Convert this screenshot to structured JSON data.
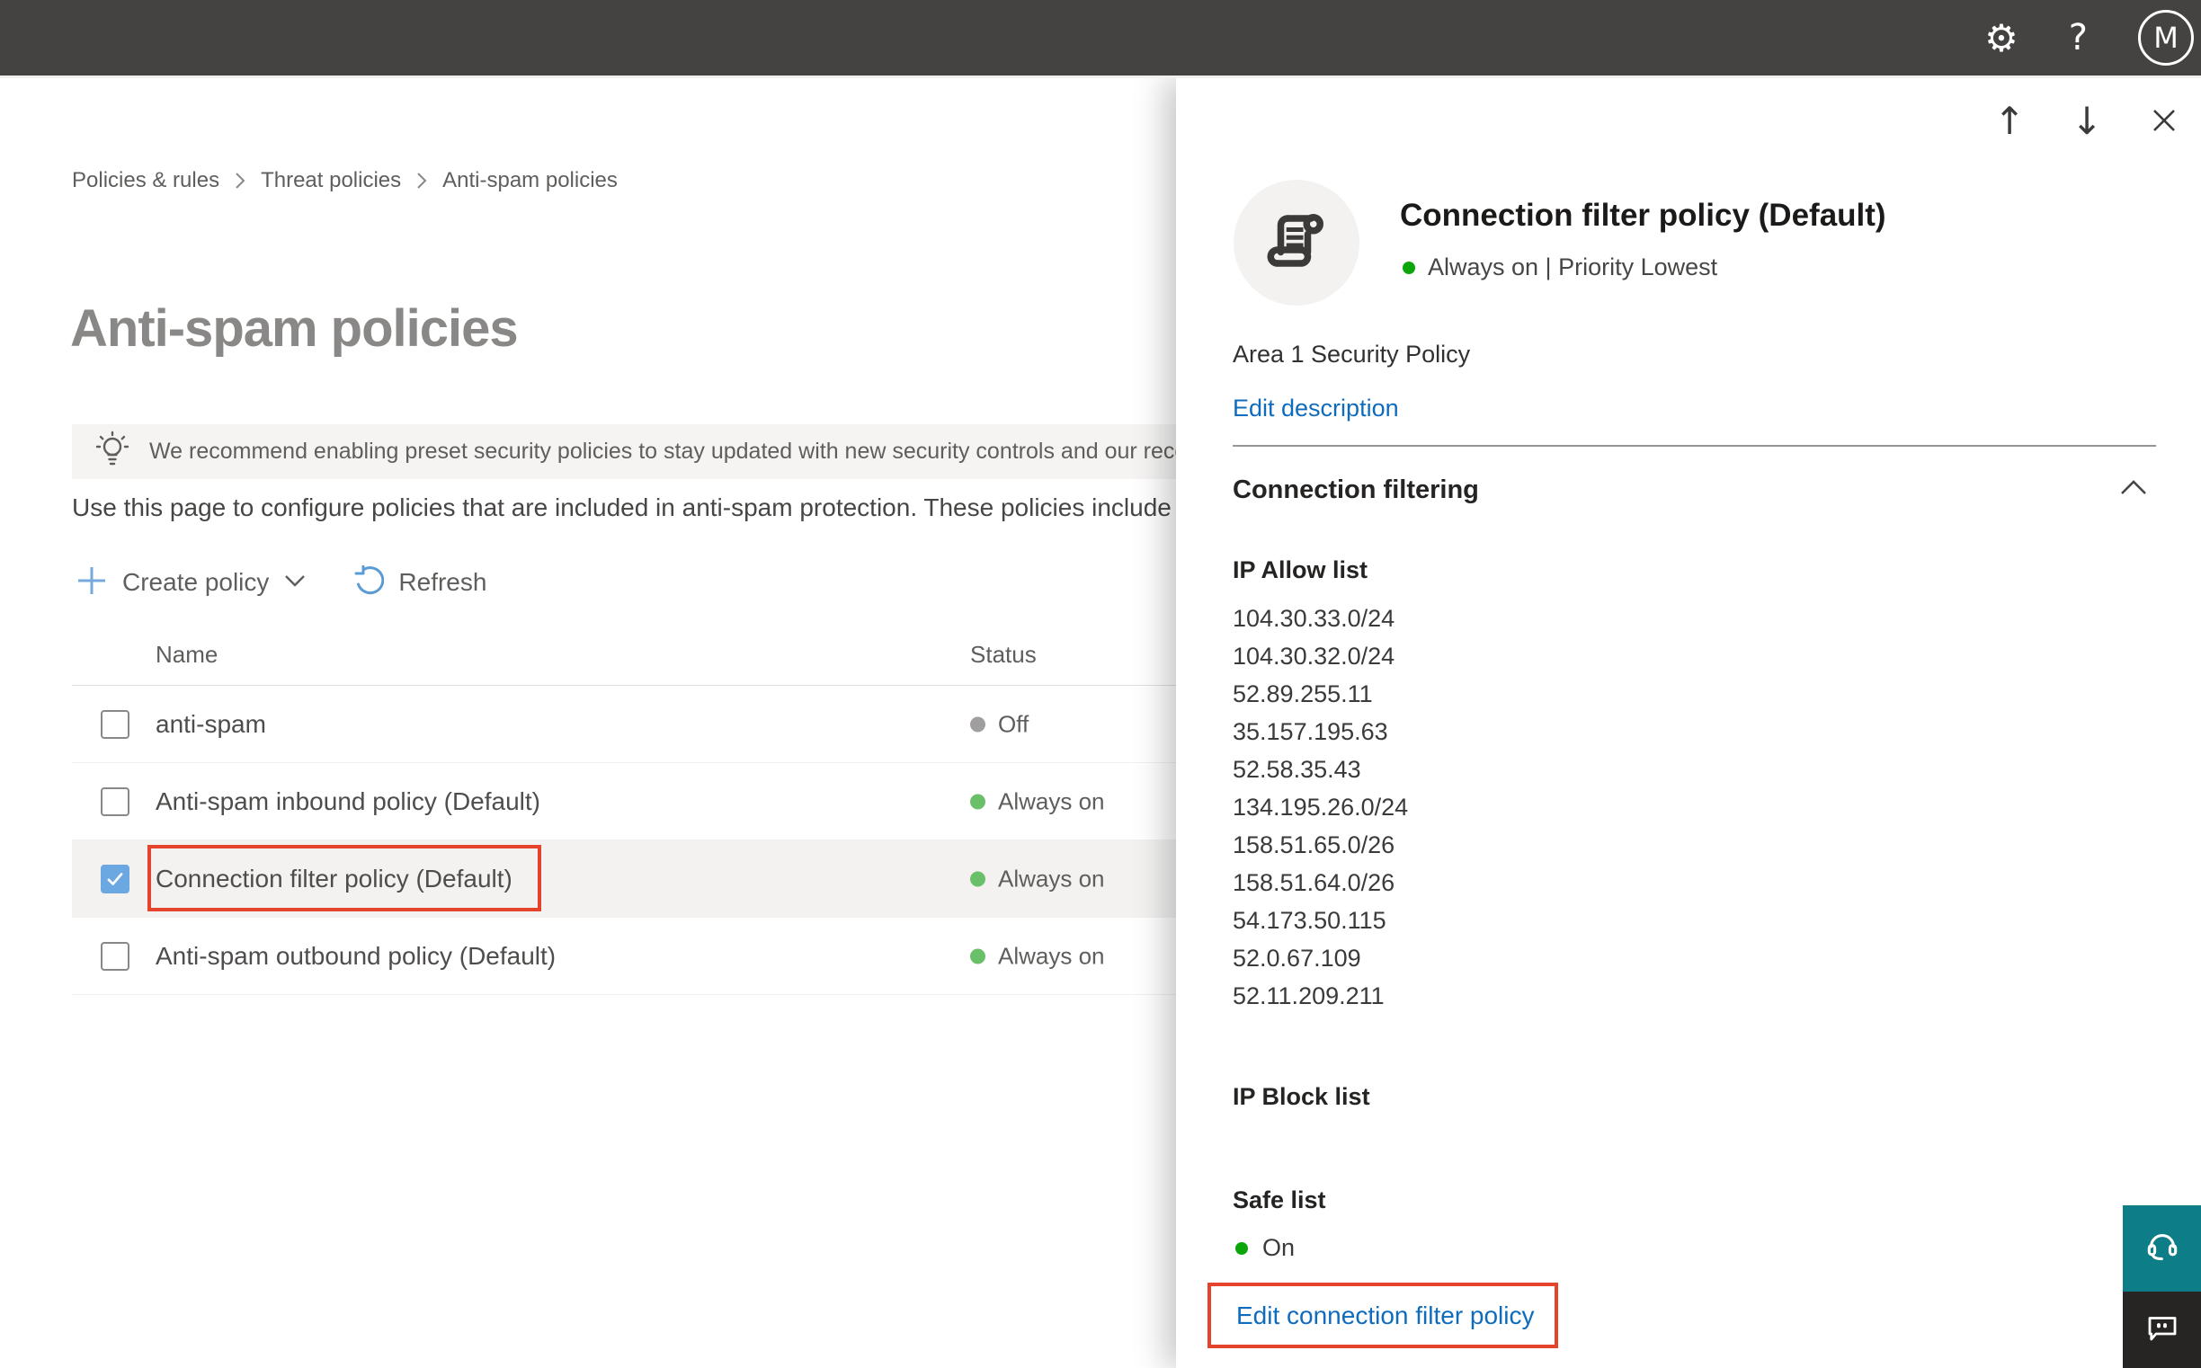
{
  "topbar": {
    "avatar_initial": "M"
  },
  "breadcrumb": {
    "items": [
      "Policies & rules",
      "Threat policies",
      "Anti-spam policies"
    ]
  },
  "page": {
    "title": "Anti-spam policies",
    "banner": "We recommend enabling preset security policies to stay updated with new security controls and our recomme",
    "description": "Use this page to configure policies that are included in anti-spam protection. These policies include"
  },
  "toolbar": {
    "create": "Create policy",
    "refresh": "Refresh"
  },
  "table": {
    "columns": [
      "Name",
      "Status"
    ],
    "rows": [
      {
        "name": "anti-spam",
        "status": "Off",
        "status_color": "gray",
        "checked": false,
        "selected": false,
        "annotated": false
      },
      {
        "name": "Anti-spam inbound policy (Default)",
        "status": "Always on",
        "status_color": "green",
        "checked": false,
        "selected": false,
        "annotated": false
      },
      {
        "name": "Connection filter policy (Default)",
        "status": "Always on",
        "status_color": "green",
        "checked": true,
        "selected": true,
        "annotated": true
      },
      {
        "name": "Anti-spam outbound policy (Default)",
        "status": "Always on",
        "status_color": "green",
        "checked": false,
        "selected": false,
        "annotated": false
      }
    ]
  },
  "flyout": {
    "title": "Connection filter policy (Default)",
    "status_line": "Always on | Priority Lowest",
    "description": "Area 1 Security Policy",
    "edit_description": "Edit description",
    "section_title": "Connection filtering",
    "ip_allow_title": "IP Allow list",
    "ip_allow": [
      "104.30.33.0/24",
      "104.30.32.0/24",
      "52.89.255.11",
      "35.157.195.63",
      "52.58.35.43",
      "134.195.26.0/24",
      "158.51.65.0/26",
      "158.51.64.0/26",
      "54.173.50.115",
      "52.0.67.109",
      "52.11.209.211"
    ],
    "ip_block_title": "IP Block list",
    "safe_list_title": "Safe list",
    "safe_list_status": "On",
    "edit_link": "Edit connection filter policy"
  },
  "icons": {
    "topbar": [
      "settings-gear-icon",
      "help-icon",
      "account-avatar"
    ],
    "flyout_nav": [
      "arrow-up-icon",
      "arrow-down-icon",
      "close-icon"
    ],
    "toolbar": [
      "plus-icon",
      "chevron-down-icon",
      "refresh-icon"
    ],
    "banner": "lightbulb-icon",
    "flyout_header": "policy-scroll-icon",
    "floating": [
      "headset-icon",
      "chat-bubble-icon"
    ]
  },
  "colors": {
    "accent_blue": "#0f6cbd",
    "annotation_red": "#e5432c",
    "status_green_bright": "#0ca50c",
    "status_green_soft": "#6abf69",
    "status_gray": "#a19f9d",
    "support_teal": "#0d7d87",
    "chat_dark": "#262524",
    "topbar_dark": "#454341"
  }
}
